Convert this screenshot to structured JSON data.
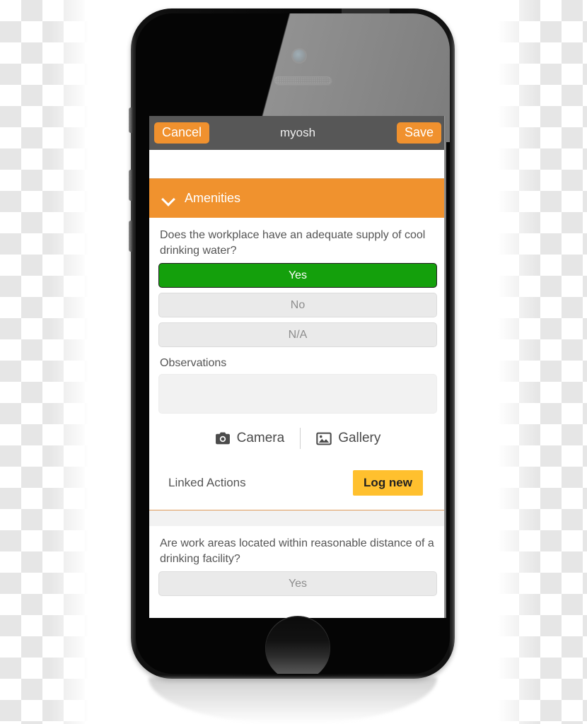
{
  "app": {
    "navbar": {
      "cancel_label": "Cancel",
      "title": "myosh",
      "save_label": "Save"
    },
    "section": {
      "title": "Amenities",
      "chevron_icon": "chevron-down-icon",
      "expanded": true
    },
    "questions": [
      {
        "text": "Does the workplace have an adequate supply of cool drinking water?",
        "options": [
          "Yes",
          "No",
          "N/A"
        ],
        "selected": "Yes",
        "observations": {
          "label": "Observations",
          "value": "",
          "placeholder": ""
        },
        "attachments": [
          {
            "label": "Camera",
            "icon": "camera-icon"
          },
          {
            "label": "Gallery",
            "icon": "gallery-icon"
          }
        ],
        "linked_actions": {
          "label": "Linked Actions",
          "button_label": "Log new"
        }
      },
      {
        "text": "Are work areas located within reasonable distance of a drinking facility?",
        "options": [
          "Yes"
        ],
        "selected": ""
      }
    ]
  },
  "colors": {
    "brand_orange": "#f0922e",
    "selected_green": "#14a00c",
    "log_new_amber": "#ffc02e",
    "navbar_gray": "#575757",
    "option_gray": "#eaeaea"
  },
  "device": {
    "front_camera": "front-camera-icon",
    "earpiece": "earpiece-speaker-icon",
    "home_button": "home-button"
  }
}
